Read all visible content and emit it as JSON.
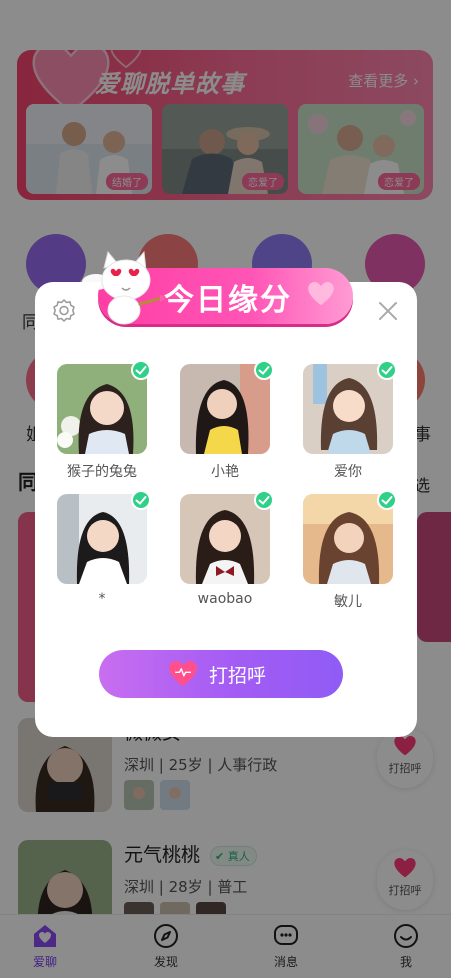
{
  "banner": {
    "title": "爱聊脱单故事",
    "more": "查看更多 ›"
  },
  "stories": [
    {
      "tag": "结婚了"
    },
    {
      "tag": "恋爱了"
    },
    {
      "tag": "恋爱了"
    }
  ],
  "edge_labels": {
    "row1_left": "同",
    "row1_right": "",
    "row2_left": "姐",
    "row2_right": "事"
  },
  "section": {
    "title": "同",
    "right": "选"
  },
  "users": [
    {
      "name": "微微女",
      "info": "深圳 | 25岁 | 人事行政",
      "greet": "打招呼"
    },
    {
      "name": "元气桃桃",
      "badge": "真人",
      "info": "深圳 | 28岁 | 普工",
      "greet": "打招呼"
    }
  ],
  "tabs": [
    {
      "label": "爱聊",
      "icon": "home-heart-icon"
    },
    {
      "label": "发现",
      "icon": "compass-icon"
    },
    {
      "label": "消息",
      "icon": "chat-icon"
    },
    {
      "label": "我",
      "icon": "smile-icon"
    }
  ],
  "modal": {
    "title": "今日缘分",
    "candidates": [
      {
        "name": "猴子的兔兔"
      },
      {
        "name": "小艳"
      },
      {
        "name": "爱你"
      },
      {
        "name": "*"
      },
      {
        "name": "waobao"
      },
      {
        "name": "敏儿"
      }
    ],
    "action": "打招呼"
  },
  "colors": {
    "accent": "#ff3ea5",
    "button": "#a35cf4",
    "check": "#2fd188",
    "banner": "#f7446e"
  }
}
